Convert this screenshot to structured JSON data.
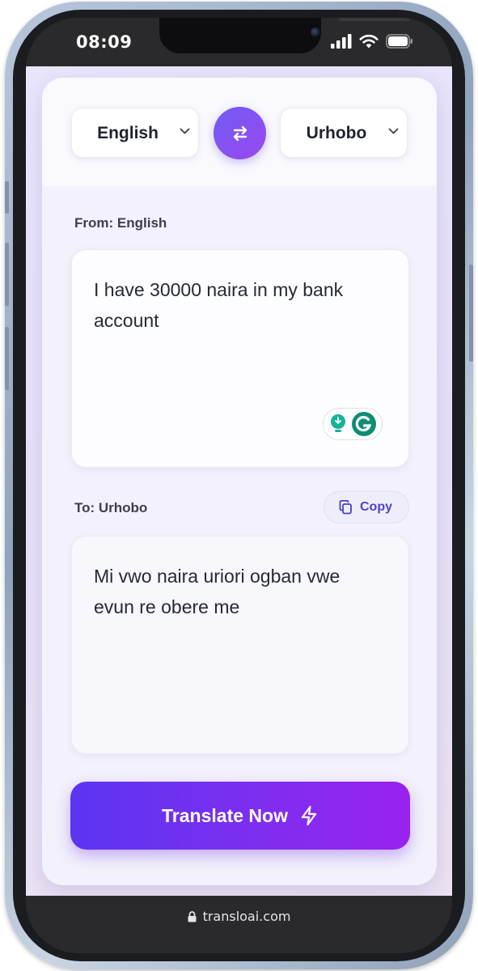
{
  "status_bar": {
    "time": "08:09",
    "icons": [
      "cellular-signal-icon",
      "wifi-icon",
      "battery-icon"
    ]
  },
  "language_selector": {
    "source_language": "English",
    "target_language": "Urhobo",
    "swap_icon": "swap-arrows-icon"
  },
  "source": {
    "label": "From: English",
    "text": "I have 30000 naira in my bank account",
    "extension_icons": [
      "lightbulb-icon",
      "grammarly-icon"
    ]
  },
  "target": {
    "label": "To: Urhobo",
    "copy_label": "Copy",
    "text": "Mi vwo naira uriori ogban vwe evun re obere me"
  },
  "action": {
    "translate_label": "Translate Now",
    "icon": "lightning-icon"
  },
  "browser": {
    "url": "transloai.com",
    "icon": "lock-icon"
  },
  "colors": {
    "accent_start": "#5b35f2",
    "accent_end": "#9a22ee",
    "copy_text": "#5046c6"
  }
}
